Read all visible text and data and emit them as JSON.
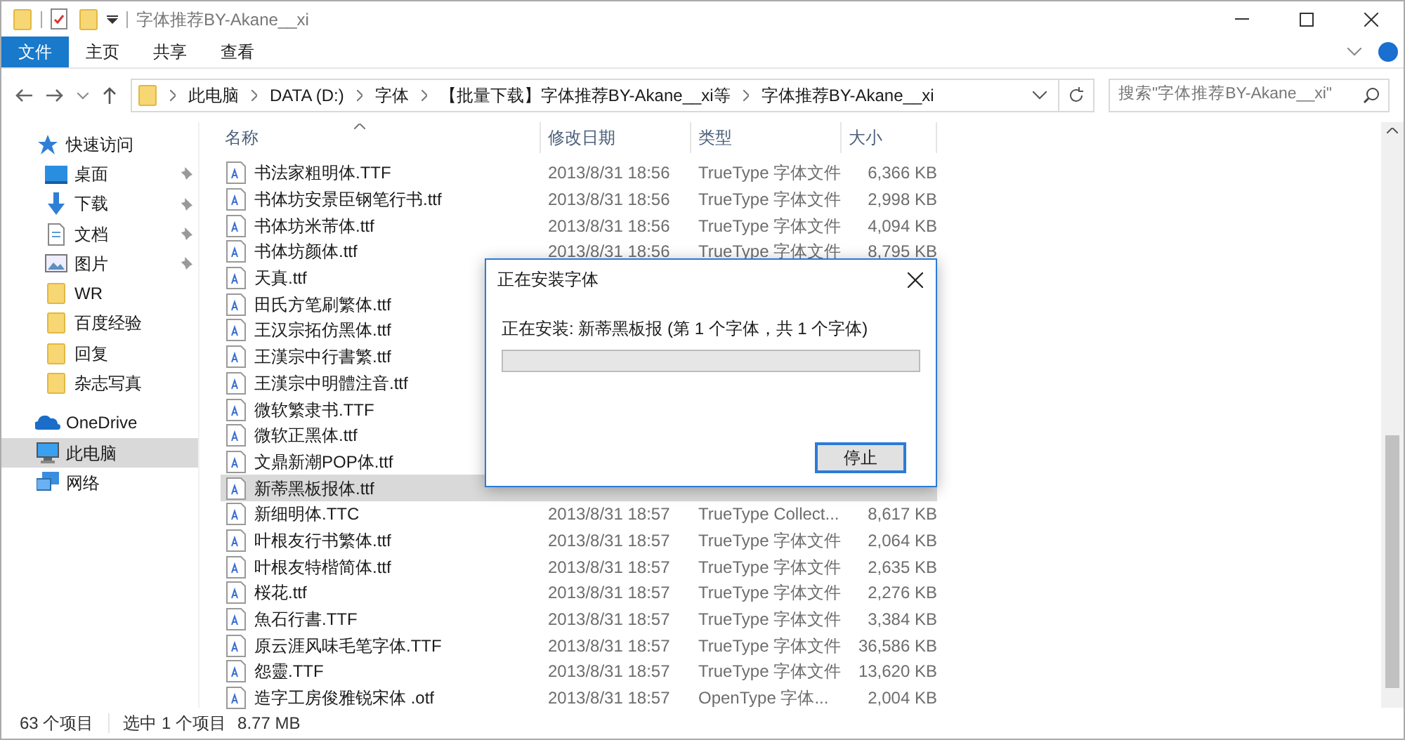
{
  "window": {
    "title": "字体推荐BY-Akane__xi"
  },
  "ribbon_tabs": [
    {
      "label": "文件",
      "kind": "file"
    },
    {
      "label": "主页",
      "kind": "tab"
    },
    {
      "label": "共享",
      "kind": "tab"
    },
    {
      "label": "查看",
      "kind": "tab"
    }
  ],
  "address_bar": {
    "crumbs": [
      "此电脑",
      "DATA (D:)",
      "字体",
      "【批量下载】字体推荐BY-Akane__xi等",
      "字体推荐BY-Akane__xi"
    ]
  },
  "search": {
    "placeholder": "搜索\"字体推荐BY-Akane__xi\""
  },
  "sidebar": {
    "items": [
      {
        "label": "快速访问",
        "kind": "star",
        "section": true,
        "pinned": false,
        "selected": false
      },
      {
        "label": "桌面",
        "kind": "desktop",
        "section": false,
        "pinned": true,
        "selected": false
      },
      {
        "label": "下载",
        "kind": "download",
        "section": false,
        "pinned": true,
        "selected": false
      },
      {
        "label": "文档",
        "kind": "document",
        "section": false,
        "pinned": true,
        "selected": false
      },
      {
        "label": "图片",
        "kind": "picture",
        "section": false,
        "pinned": true,
        "selected": false
      },
      {
        "label": "WR",
        "kind": "folder",
        "section": false,
        "pinned": false,
        "selected": false
      },
      {
        "label": "百度经验",
        "kind": "folder",
        "section": false,
        "pinned": false,
        "selected": false
      },
      {
        "label": "回复",
        "kind": "folder",
        "section": false,
        "pinned": false,
        "selected": false
      },
      {
        "label": "杂志写真",
        "kind": "folder",
        "section": false,
        "pinned": false,
        "selected": false
      },
      {
        "label": "OneDrive",
        "kind": "cloud",
        "section": true,
        "pinned": false,
        "selected": false
      },
      {
        "label": "此电脑",
        "kind": "computer",
        "section": true,
        "pinned": false,
        "selected": true
      },
      {
        "label": "网络",
        "kind": "network",
        "section": true,
        "pinned": false,
        "selected": false
      }
    ]
  },
  "table": {
    "columns": [
      "名称",
      "修改日期",
      "类型",
      "大小"
    ],
    "rows": [
      {
        "name": "书法家粗明体.TTF",
        "date": "2013/8/31 18:56",
        "type": "TrueType 字体文件",
        "size": "6,366 KB",
        "selected": false
      },
      {
        "name": "书体坊安景臣钢笔行书.ttf",
        "date": "2013/8/31 18:56",
        "type": "TrueType 字体文件",
        "size": "2,998 KB",
        "selected": false
      },
      {
        "name": "书体坊米芾体.ttf",
        "date": "2013/8/31 18:56",
        "type": "TrueType 字体文件",
        "size": "4,094 KB",
        "selected": false
      },
      {
        "name": "书体坊颜体.ttf",
        "date": "2013/8/31 18:56",
        "type": "TrueType 字体文件",
        "size": "8,795 KB",
        "selected": false
      },
      {
        "name": "天真.ttf",
        "selected": false
      },
      {
        "name": "田氏方笔刷繁体.ttf",
        "selected": false
      },
      {
        "name": "王汉宗拓仿黑体.ttf",
        "selected": false
      },
      {
        "name": "王漢宗中行書繁.ttf",
        "selected": false
      },
      {
        "name": "王漢宗中明體注音.ttf",
        "selected": false
      },
      {
        "name": "微软繁隶书.TTF",
        "selected": false
      },
      {
        "name": "微软正黑体.ttf",
        "selected": false
      },
      {
        "name": "文鼎新潮POP体.ttf",
        "selected": false
      },
      {
        "name": "新蒂黑板报体.ttf",
        "selected": true
      },
      {
        "name": "新细明体.TTC",
        "date": "2013/8/31 18:57",
        "type": "TrueType Collect...",
        "size": "8,617 KB",
        "selected": false
      },
      {
        "name": "叶根友行书繁体.ttf",
        "date": "2013/8/31 18:57",
        "type": "TrueType 字体文件",
        "size": "2,064 KB",
        "selected": false
      },
      {
        "name": "叶根友特楷简体.ttf",
        "date": "2013/8/31 18:57",
        "type": "TrueType 字体文件",
        "size": "2,635 KB",
        "selected": false
      },
      {
        "name": "桜花.ttf",
        "date": "2013/8/31 18:57",
        "type": "TrueType 字体文件",
        "size": "2,276 KB",
        "selected": false
      },
      {
        "name": "魚石行書.TTF",
        "date": "2013/8/31 18:57",
        "type": "TrueType 字体文件",
        "size": "3,384 KB",
        "selected": false
      },
      {
        "name": "原云涯风味毛笔字体.TTF",
        "date": "2013/8/31 18:57",
        "type": "TrueType 字体文件",
        "size": "36,586 KB",
        "selected": false
      },
      {
        "name": "怨靈.TTF",
        "date": "2013/8/31 18:57",
        "type": "TrueType 字体文件",
        "size": "13,620 KB",
        "selected": false
      },
      {
        "name": "造字工房俊雅锐宋体 .otf",
        "date": "2013/8/31 18:57",
        "type": "OpenType 字体...",
        "size": "2,004 KB",
        "selected": false
      }
    ]
  },
  "status_bar": {
    "count": "63 个项目",
    "selection": "选中 1 个项目",
    "size": "8.77 MB"
  },
  "dialog": {
    "title": "正在安装字体",
    "message": "正在安装: 新蒂黑板报 (第 1 个字体，共 1 个字体)",
    "progress": {
      "level": 0
    },
    "button": "停止"
  }
}
